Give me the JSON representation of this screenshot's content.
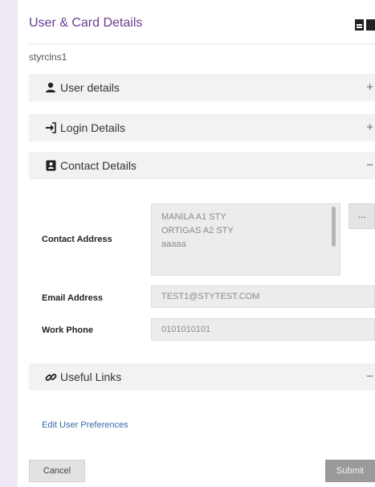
{
  "header": {
    "title": "User & Card Details",
    "icons": [
      "pdf-icon",
      "doc-icon"
    ]
  },
  "user": {
    "username": "styrclns1"
  },
  "sections": [
    {
      "label": "User details",
      "icon": "user-icon",
      "toggle": "+"
    },
    {
      "label": "Login Details",
      "icon": "login-icon",
      "toggle": "+"
    },
    {
      "label": "Contact Details",
      "icon": "address-card-icon",
      "toggle": "−"
    },
    {
      "label": "Useful Links",
      "icon": "link-icon",
      "toggle": "−"
    }
  ],
  "contact": {
    "address_label": "Contact Address",
    "address_lines": [
      "MANILA A1 STY",
      "ORTIGAS A2 STY",
      "aaaaa"
    ],
    "address_more_label": "...",
    "email_label": "Email Address",
    "email_value": "TEST1@STYTEST.COM",
    "phone_label": "Work Phone",
    "phone_value": "0101010101"
  },
  "links": {
    "edit_preferences": "Edit User Preferences"
  },
  "footer": {
    "cancel_label": "Cancel",
    "submit_label": "Submit"
  }
}
